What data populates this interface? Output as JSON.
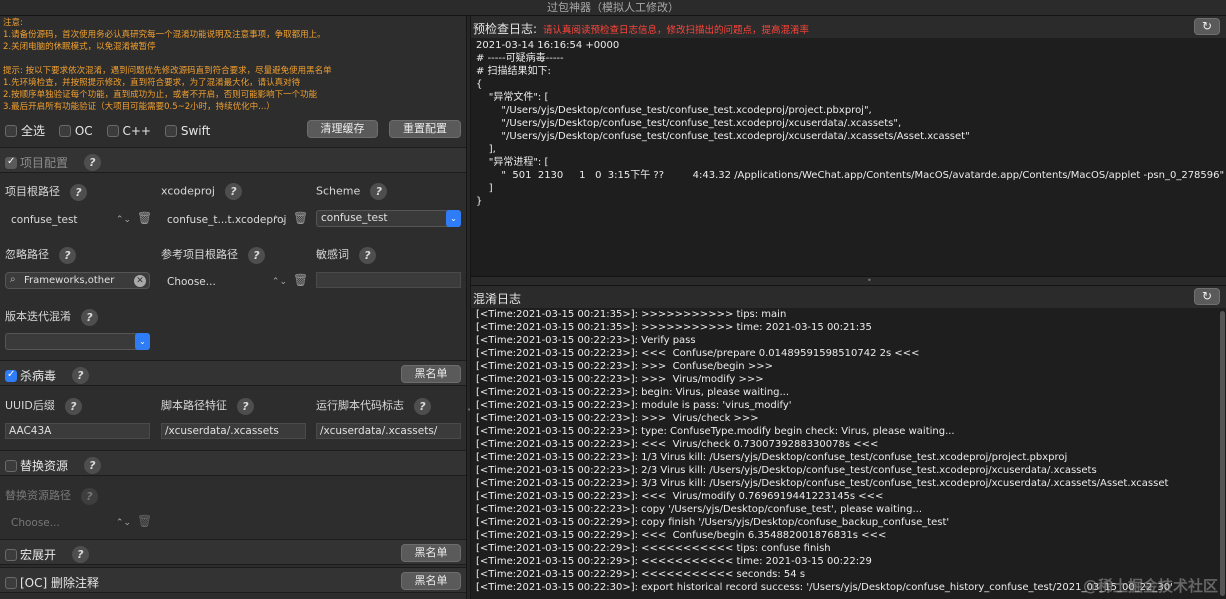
{
  "window": {
    "title": "过包神器（模拟人工修改）"
  },
  "notes": [
    "注意:",
    "1.请备份源码，首次使用务必认真研究每一个混淆功能说明及注意事项，争取都用上。",
    "2.关闭电脑的休眠模式，以免混淆被暂停",
    "",
    "提示: 按以下要求依次混淆，遇到问题优先修改源码直到符合要求，尽量避免使用黑名单",
    "1.先环境检查，并按照提示修改，直到符合要求，为了混淆最大化，请认真对待",
    "2.按顺序单独验证每个功能，直到成功为止，或者不开启，否则可能影响下一个功能",
    "3.最后开启所有功能验证（大项目可能需要0.5~2小时，持续优化中...）"
  ],
  "languages": {
    "select_all": "全选",
    "oc": "OC",
    "cpp": "C++",
    "swift": "Swift",
    "clear_cache": "清理缓存",
    "reset_config": "重置配置"
  },
  "project_config": {
    "title": "项目配置",
    "root_label": "项目根路径",
    "root_value": "confuse_test",
    "xcodeproj_label": "xcodeproj",
    "xcodeproj_value": "confuse_t...t.xcodeproj",
    "scheme_label": "Scheme",
    "scheme_value": "confuse_test",
    "ignore_label": "忽略路径",
    "ignore_value": "Frameworks,other",
    "ref_root_label": "参考项目根路径",
    "ref_root_value": "Choose...",
    "sensitive_label": "敏感词",
    "version_label": "版本迭代混淆"
  },
  "antivirus": {
    "title": "杀病毒",
    "blacklist": "黑名单",
    "uuid_label": "UUID后缀",
    "uuid_value": "AAC43A",
    "script_path_label": "脚本路径特征",
    "script_path_value": "/xcuserdata/.xcassets",
    "run_script_label": "运行脚本代码标志",
    "run_script_value": "/xcuserdata/.xcassets/"
  },
  "replace_resources": {
    "title": "替换资源",
    "path_label": "替换资源路径",
    "path_value": "Choose..."
  },
  "macro": {
    "title": "宏展开",
    "blacklist": "黑名单"
  },
  "remove_comments": {
    "title": "[OC] 删除注释",
    "blacklist": "黑名单"
  },
  "precheck": {
    "title": "预检查日志:",
    "warning": "请认真阅读预检查日志信息，修改扫描出的问题点，提高混淆率",
    "lines": [
      "2021-03-14 16:16:54 +0000",
      "# -----可疑病毒-----",
      "# 扫描结果如下:",
      "{",
      "    \"异常文件\": [",
      "        \"/Users/yjs/Desktop/confuse_test/confuse_test.xcodeproj/project.pbxproj\",",
      "        \"/Users/yjs/Desktop/confuse_test/confuse_test.xcodeproj/xcuserdata/.xcassets\",",
      "        \"/Users/yjs/Desktop/confuse_test/confuse_test.xcodeproj/xcuserdata/.xcassets/Asset.xcasset\"",
      "    ],",
      "    \"异常进程\": [",
      "        \"  501  2130     1   0  3:15下午 ??         4:43.32 /Applications/WeChat.app/Contents/MacOS/avatarde.app/Contents/MacOS/applet -psn_0_278596\"",
      "    ]",
      "}"
    ]
  },
  "confuse_log": {
    "title": "混淆日志",
    "lines": [
      "[<Time:2021-03-15 00:21:35>]: >>>>>>>>>>> tips: main",
      "[<Time:2021-03-15 00:21:35>]: >>>>>>>>>>> time: 2021-03-15 00:21:35",
      "[<Time:2021-03-15 00:22:23>]: Verify pass",
      "[<Time:2021-03-15 00:22:23>]: <<<  Confuse/prepare 0.01489591598510742 2s <<<",
      "[<Time:2021-03-15 00:22:23>]: >>>  Confuse/begin >>>",
      "[<Time:2021-03-15 00:22:23>]: >>>  Virus/modify >>>",
      "[<Time:2021-03-15 00:22:23>]: begin: Virus, please waiting...",
      "[<Time:2021-03-15 00:22:23>]: module is pass: 'virus_modify'",
      "[<Time:2021-03-15 00:22:23>]: >>>  Virus/check >>>",
      "[<Time:2021-03-15 00:22:23>]: type: ConfuseType.modify begin check: Virus, please waiting...",
      "[<Time:2021-03-15 00:22:23>]: <<<  Virus/check 0.7300739288330078s <<<",
      "[<Time:2021-03-15 00:22:23>]: 1/3 Virus kill: /Users/yjs/Desktop/confuse_test/confuse_test.xcodeproj/project.pbxproj",
      "[<Time:2021-03-15 00:22:23>]: 2/3 Virus kill: /Users/yjs/Desktop/confuse_test/confuse_test.xcodeproj/xcuserdata/.xcassets",
      "[<Time:2021-03-15 00:22:23>]: 3/3 Virus kill: /Users/yjs/Desktop/confuse_test/confuse_test.xcodeproj/xcuserdata/.xcassets/Asset.xcasset",
      "[<Time:2021-03-15 00:22:23>]: <<<  Virus/modify 0.7696919441223145s <<<",
      "[<Time:2021-03-15 00:22:23>]: copy '/Users/yjs/Desktop/confuse_test', please waiting...",
      "[<Time:2021-03-15 00:22:29>]: copy finish '/Users/yjs/Desktop/confuse_backup_confuse_test'",
      "[<Time:2021-03-15 00:22:29>]: <<<  Confuse/begin 6.354882001876831s <<<",
      "[<Time:2021-03-15 00:22:29>]: <<<<<<<<<<< tips: confuse finish",
      "[<Time:2021-03-15 00:22:29>]: <<<<<<<<<<< time: 2021-03-15 00:22:29",
      "[<Time:2021-03-15 00:22:29>]: <<<<<<<<<<< seconds: 54 s",
      "[<Time:2021-03-15 00:22:30>]: export historical record success: '/Users/yjs/Desktop/confuse_history_confuse_test/2021_03_15_00_22_30'"
    ]
  },
  "watermark": "@稀土掘金技术社区",
  "icons": {
    "help": "?",
    "refresh": "↻",
    "trash": "🗑",
    "search": "⌕",
    "clear": "✕",
    "updown": "⌃⌄",
    "dropdown": "⌄"
  }
}
